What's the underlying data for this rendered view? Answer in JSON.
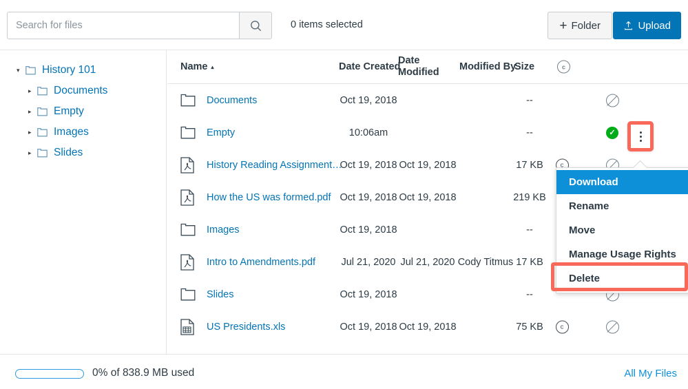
{
  "toolbar": {
    "search_placeholder": "Search for files",
    "search_value": "",
    "search_icon": "search-icon",
    "selected_count": "0 items selected",
    "folder_button": "Folder",
    "folder_icon": "plus-icon",
    "upload_button": "Upload",
    "upload_icon": "upload-arrow-icon",
    "upload_bg": "#0374b5"
  },
  "sidebar": {
    "items": [
      {
        "label": "History 101",
        "level": 0,
        "caret": "▾",
        "expanded": true
      },
      {
        "label": "Documents",
        "level": 1,
        "caret": "▸",
        "expanded": false
      },
      {
        "label": "Empty",
        "level": 1,
        "caret": "▸",
        "expanded": false
      },
      {
        "label": "Images",
        "level": 1,
        "caret": "▸",
        "expanded": false
      },
      {
        "label": "Slides",
        "level": 1,
        "caret": "▸",
        "expanded": false
      }
    ]
  },
  "table": {
    "headers": {
      "name": "Name",
      "sort_indicator": "▴",
      "date_created": "Date Created",
      "date_modified": "Date Modified",
      "modified_by": "Modified By",
      "size": "Size",
      "usage_rights_icon": "copyright-circle-icon"
    },
    "rows": [
      {
        "icon": "folder-icon",
        "name": "Documents",
        "date_created": "Oct 19, 2018",
        "date_modified": "",
        "modified_by": "",
        "size": "--",
        "rights_icon": "",
        "published_icon": "blocked-circle-icon"
      },
      {
        "icon": "folder-icon",
        "name": "Empty",
        "date_created": "10:06am",
        "date_modified": "",
        "modified_by": "",
        "size": "--",
        "rights_icon": "",
        "published_icon": "published-check-icon"
      },
      {
        "icon": "pdf-file-icon",
        "name": "History Reading Assignment…",
        "date_created": "Oct 19, 2018",
        "date_modified": "Oct 19, 2018",
        "modified_by": "",
        "size": "17 KB",
        "rights_icon": "copyright-circle-icon",
        "published_icon": "blocked-circle-icon"
      },
      {
        "icon": "pdf-file-icon",
        "name": "How the US was formed.pdf",
        "date_created": "Oct 19, 2018",
        "date_modified": "Oct 19, 2018",
        "modified_by": "",
        "size": "219 KB",
        "rights_icon": "warning-circle-icon",
        "published_icon": "blocked-circle-icon"
      },
      {
        "icon": "folder-icon",
        "name": "Images",
        "date_created": "Oct 19, 2018",
        "date_modified": "",
        "modified_by": "",
        "size": "--",
        "rights_icon": "",
        "published_icon": "blocked-circle-icon"
      },
      {
        "icon": "pdf-file-icon",
        "name": "Intro to Amendments.pdf",
        "date_created": "Jul 21, 2020",
        "date_modified": "Jul 21, 2020",
        "modified_by": "Cody Titmus",
        "size": "17 KB",
        "rights_icon": "copyright-circle-icon",
        "published_icon": "blocked-circle-icon"
      },
      {
        "icon": "folder-icon",
        "name": "Slides",
        "date_created": "Oct 19, 2018",
        "date_modified": "",
        "modified_by": "",
        "size": "--",
        "rights_icon": "",
        "published_icon": "blocked-circle-icon"
      },
      {
        "icon": "spreadsheet-icon",
        "name": "US Presidents.xls",
        "date_created": "Oct 19, 2018",
        "date_modified": "Oct 19, 2018",
        "modified_by": "",
        "size": "75 KB",
        "rights_icon": "copyright-circle-icon",
        "published_icon": "blocked-circle-icon"
      }
    ]
  },
  "context_menu": {
    "open": true,
    "trigger_icon": "kebab-menu-icon",
    "highlight_color": "#f9695a",
    "active_bg": "#0e90d9",
    "items": [
      {
        "label": "Download",
        "state": "active"
      },
      {
        "label": "Rename",
        "state": "normal"
      },
      {
        "label": "Move",
        "state": "normal"
      },
      {
        "label": "Manage Usage Rights",
        "state": "normal"
      },
      {
        "label": "Delete",
        "state": "highlighted"
      }
    ]
  },
  "footer": {
    "quota_text": "0% of 838.9 MB used",
    "quota_percent": 0,
    "all_files_link": "All My Files",
    "link_color": "#0e90d9"
  }
}
